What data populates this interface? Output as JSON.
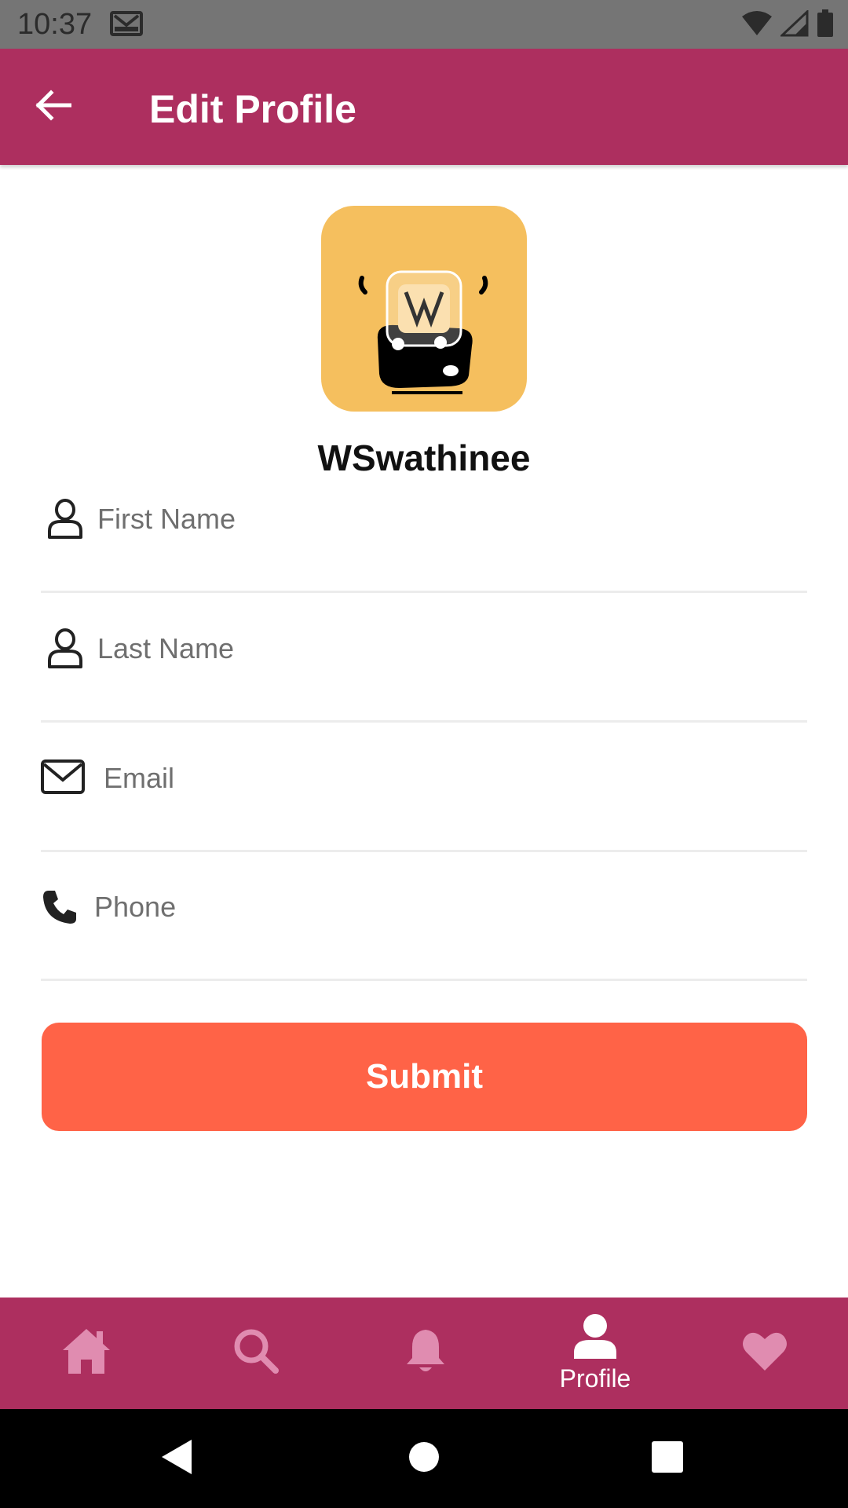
{
  "status_bar": {
    "time": "10:37",
    "icons": [
      "gmail-icon",
      "wifi-icon",
      "signal-icon",
      "battery-icon"
    ]
  },
  "app_bar": {
    "title": "Edit Profile",
    "back_icon": "arrow-left-icon",
    "background": "#ad2f5f"
  },
  "profile": {
    "username": "WSwathinee",
    "avatar_background": "#f5bf5e"
  },
  "form": {
    "fields": [
      {
        "icon": "person-icon",
        "placeholder": "First Name",
        "value": ""
      },
      {
        "icon": "person-icon",
        "placeholder": "Last Name",
        "value": ""
      },
      {
        "icon": "envelope-icon",
        "placeholder": "Email",
        "value": ""
      },
      {
        "icon": "phone-icon",
        "placeholder": "Phone",
        "value": ""
      }
    ],
    "submit_label": "Submit",
    "submit_color": "#ff6347"
  },
  "bottom_nav": {
    "items": [
      {
        "icon": "home-icon",
        "label": "",
        "active": false
      },
      {
        "icon": "search-icon",
        "label": "",
        "active": false
      },
      {
        "icon": "bell-icon",
        "label": "",
        "active": false
      },
      {
        "icon": "profile-icon",
        "label": "Profile",
        "active": true
      },
      {
        "icon": "heart-icon",
        "label": "",
        "active": false
      }
    ],
    "inactive_color": "#e08cb0",
    "active_color": "#ffffff"
  },
  "system_nav": [
    "back-triangle-icon",
    "home-circle-icon",
    "recents-square-icon"
  ]
}
